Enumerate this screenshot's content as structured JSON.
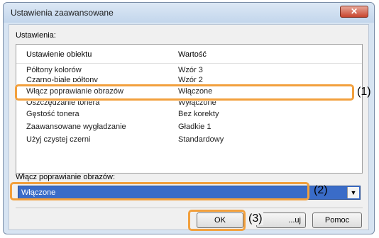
{
  "window": {
    "title": "Ustawienia zaawansowane",
    "close_glyph": "✕"
  },
  "settings_label": "Ustawienia:",
  "list": {
    "headers": {
      "name": "Ustawienie obiektu",
      "value": "Wartość"
    },
    "rows": [
      {
        "name": "Półtony kolorów",
        "value": "Wzór 3"
      },
      {
        "name": "Czarno-białe półtony",
        "value": "Wzór 2"
      },
      {
        "name": "Włącz poprawianie obrazów",
        "value": "Włączone"
      },
      {
        "name": "Oszczędzanie tonera",
        "value": "Wyłączone"
      },
      {
        "name": "Gęstość tonera",
        "value": "Bez korekty"
      },
      {
        "name": "Zaawansowane wygładzanie",
        "value": "Gładkie 1"
      },
      {
        "name": "Użyj czystej czerni",
        "value": "Standardowy"
      }
    ]
  },
  "combo": {
    "label": "Włącz poprawianie obrazów:",
    "value": "Włączone",
    "arrow": "▼"
  },
  "buttons": {
    "ok": "OK",
    "apply": "Zastosuj",
    "apply_visible": "...uj",
    "help": "Pomoc"
  },
  "callouts": {
    "one": "(1)",
    "two": "(2)",
    "three": "(3)"
  },
  "colors": {
    "callout": "#f2a03d",
    "selection": "#3a6cc8"
  }
}
